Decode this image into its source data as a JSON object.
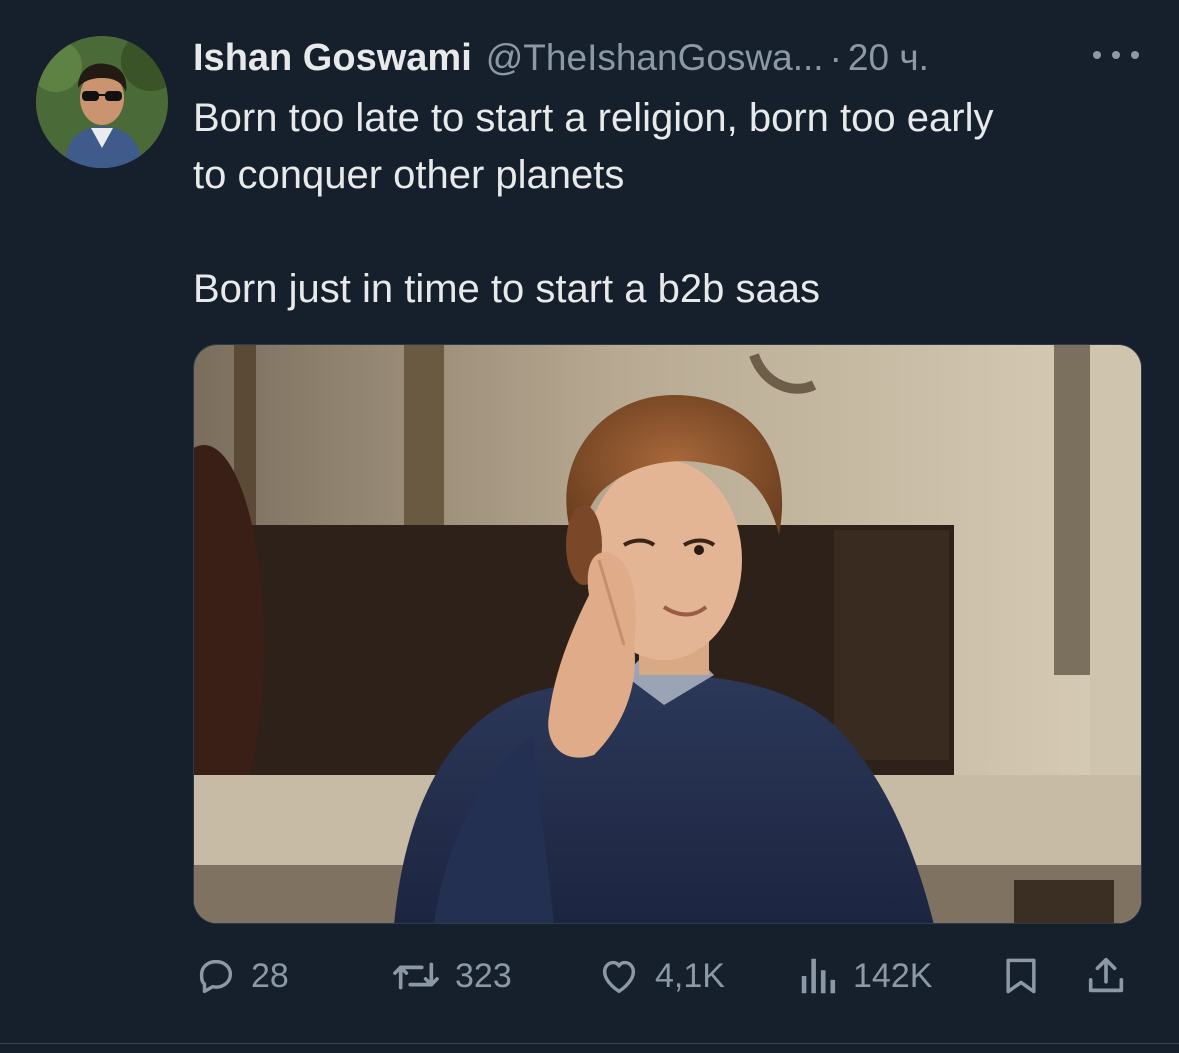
{
  "post": {
    "display_name": "Ishan Goswami",
    "handle": "@TheIshanGoswa...",
    "separator": "·",
    "time": "20 ч.",
    "text_line_1": "Born too late to start a religion, born too early",
    "text_line_2": "to conquer other planets",
    "text_line_3": "Born just in time to start a b2b saas"
  },
  "actions": {
    "replies": "28",
    "reposts": "323",
    "likes": "4,1K",
    "views": "142K"
  },
  "icons": {
    "avatar": "profile-photo",
    "more": "more-dots-icon",
    "reply": "reply-icon",
    "repost": "repost-icon",
    "like": "heart-icon",
    "views": "views-bar-chart-icon",
    "bookmark": "bookmark-icon",
    "share": "share-icon"
  },
  "colors": {
    "background": "#16202c",
    "text": "#e7e9ea",
    "secondary": "#8b98a5"
  }
}
